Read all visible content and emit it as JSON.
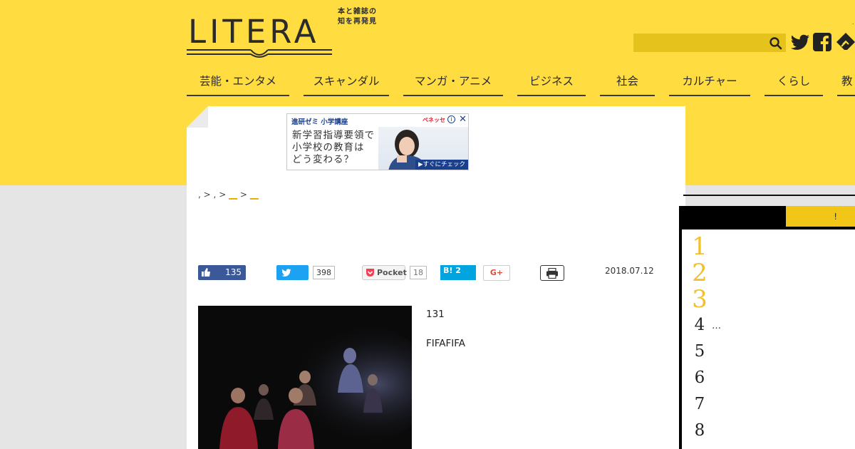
{
  "header": {
    "logo": "LITERA",
    "tagline": "本と雑誌の\n知を再発見",
    "search_placeholder": "",
    "top_dot": "."
  },
  "nav": [
    "芸能・エンタメ",
    "スキャンダル",
    "マンガ・アニメ",
    "ビジネス",
    "社会",
    "カルチャー",
    "くらし",
    "教"
  ],
  "ad": {
    "brand": "進研ゼミ 小学講座",
    "copy": "新学習指導要領で\n小学校の教育は\nどう変わる？",
    "cta": "▶すぐにチェック",
    "close": "✕",
    "info": "i",
    "logo_small": "ベネッセ"
  },
  "breadcrumb": {
    "home": ",",
    "sep1": ">",
    "item1": ",",
    "sep2": ">",
    "item2": "__",
    "sep3": ">",
    "item3": "__"
  },
  "share": {
    "facebook_count": "135",
    "twitter_count": "398",
    "pocket_label": "Pocket",
    "pocket_count": "18",
    "hatena_label": "B! 2",
    "gplus_label": "G+"
  },
  "article": {
    "date": "2018.07.12",
    "line1": "131",
    "line2": "FIFAFIFA"
  },
  "ranking": {
    "tab_label": "!",
    "items": [
      {
        "num": "1",
        "title": ""
      },
      {
        "num": "2",
        "title": ""
      },
      {
        "num": "3",
        "title": ""
      },
      {
        "num": "4",
        "title": "…"
      },
      {
        "num": "5",
        "title": ""
      },
      {
        "num": "6",
        "title": ""
      },
      {
        "num": "7",
        "title": ""
      },
      {
        "num": "8",
        "title": ""
      }
    ]
  },
  "colors": {
    "brand_yellow": "#ffdc40",
    "search_bg": "#e6c31c",
    "rank_gold": "#f2c02a",
    "facebook": "#3b5998",
    "twitter": "#1da1f2",
    "hatena": "#00a4de"
  },
  "icons": [
    "search-icon",
    "twitter-icon",
    "facebook-icon",
    "feedly-icon",
    "thumbs-up-icon",
    "pocket-icon",
    "print-icon",
    "close-icon",
    "info-icon"
  ]
}
